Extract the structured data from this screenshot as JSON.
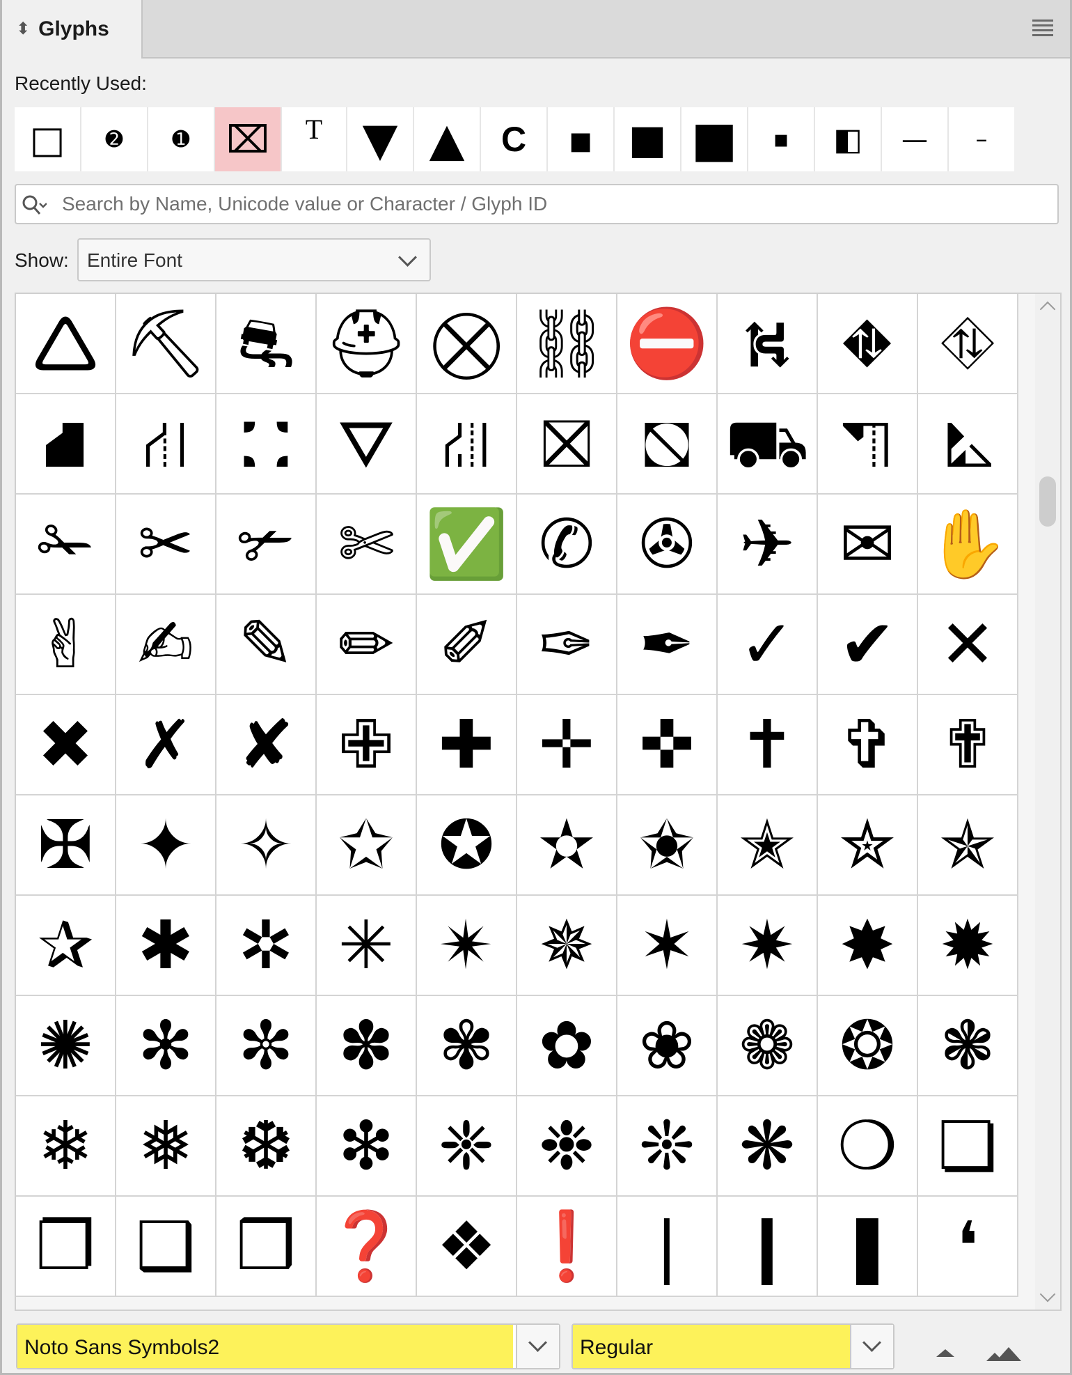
{
  "panel": {
    "title": "Glyphs"
  },
  "recent": {
    "label": "Recently Used:",
    "items": [
      "□",
      "➋",
      "➊",
      "⌧",
      "T",
      "▼",
      "▲",
      "C",
      "▪",
      "■",
      "■",
      "▪",
      "◧",
      "—",
      "–"
    ]
  },
  "search": {
    "placeholder": "Search by Name, Unicode value or Character / Glyph ID",
    "value": ""
  },
  "show": {
    "label": "Show:",
    "value": "Entire Font"
  },
  "grid": {
    "glyphs": [
      "🛆",
      "⛏",
      "⛐",
      "⛑",
      "⛒",
      "⛓",
      "⛔",
      "⛕",
      "⛖",
      "⛗",
      "⛘",
      "⛙",
      "⛚",
      "⛛",
      "⛜",
      "⛝",
      "⛞",
      "⛟",
      "⛠",
      "⛡",
      "✁",
      "✂",
      "✃",
      "✄",
      "✅",
      "✆",
      "✇",
      "✈",
      "✉",
      "✋",
      "✌",
      "✍",
      "✎",
      "✏",
      "✐",
      "✑",
      "✒",
      "✓",
      "✔",
      "✕",
      "✖",
      "✗",
      "✘",
      "✙",
      "✚",
      "✛",
      "✜",
      "✝",
      "✞",
      "✟",
      "✠",
      "✦",
      "✧",
      "✩",
      "✪",
      "✫",
      "✬",
      "✭",
      "✮",
      "✯",
      "✰",
      "✱",
      "✲",
      "✳",
      "✴",
      "✵",
      "✶",
      "✷",
      "✸",
      "✹",
      "✺",
      "✻",
      "✼",
      "✽",
      "✾",
      "✿",
      "❀",
      "❁",
      "❂",
      "❃",
      "❄",
      "❅",
      "❆",
      "❇",
      "❈",
      "❉",
      "❊",
      "❋",
      "❍",
      "❏",
      "❐",
      "❑",
      "❒",
      "❓",
      "❖",
      "❗",
      "❘",
      "❙",
      "❚",
      "❛"
    ]
  },
  "footer": {
    "font_family": "Noto Sans Symbols2",
    "font_style": "Regular"
  },
  "colors": {
    "highlight": "#fdf25a",
    "selected": "#f6c6c8"
  }
}
